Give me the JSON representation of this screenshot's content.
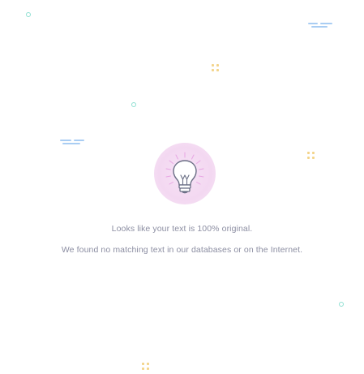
{
  "result": {
    "headline": "Looks like your text is 100% original.",
    "detail": "We found no matching text in our databases or on the Internet."
  },
  "icons": {
    "main": "lightbulb-icon",
    "decor_ring": "circle-decor-icon",
    "decor_plus": "dots-decor-icon",
    "decor_dashes": "dashes-decor-icon"
  },
  "colors": {
    "text": "#8c8ea2",
    "glow": "#f3d8f1",
    "bulb_stroke": "#6b6f86",
    "rays": "#e8a6e3",
    "ring": "#8fe0d2",
    "plus": "#f3d48a",
    "dashes": "#a9cdf3"
  }
}
